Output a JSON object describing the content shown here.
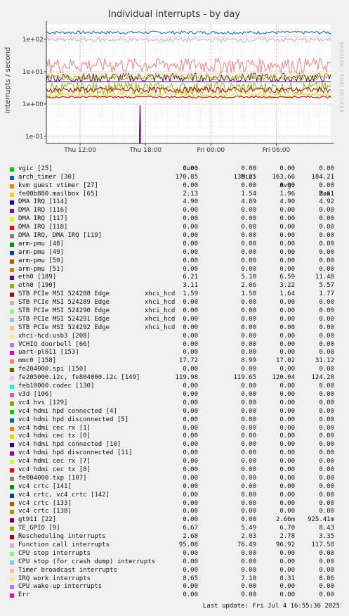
{
  "chart_data": {
    "type": "line",
    "title": "Individual interrupts - by day",
    "ylabel": "interrupts / second",
    "yscale": "log",
    "ylim": [
      0.06,
      300
    ],
    "yticks": [
      {
        "v": 100,
        "label": "1e+02"
      },
      {
        "v": 10,
        "label": "1e+01"
      },
      {
        "v": 1,
        "label": "1e+00"
      },
      {
        "v": 0.1,
        "label": "1e-01"
      }
    ],
    "x_range_hours": [
      8.9,
      35.0
    ],
    "xticks": [
      {
        "h": 12,
        "label": "Thu 12:00"
      },
      {
        "h": 18,
        "label": "Thu 18:00"
      },
      {
        "h": 24,
        "label": "Fri 00:00"
      },
      {
        "h": 30,
        "label": "Fri 06:00"
      },
      {
        "h": 36,
        "label": "Fri 12:00"
      }
    ],
    "watermark": "RRDTOOL / TOBI OETIKER",
    "columns": [
      "Cur:",
      "Min:",
      "Avg:",
      "Max:"
    ],
    "series": [
      {
        "name": "vgic [25]",
        "color": "#00cc00",
        "cur": "0.00",
        "min": "0.00",
        "avg": "0.00",
        "max": "0.00"
      },
      {
        "name": "arch_timer [30]",
        "color": "#0066b3",
        "cur": "170.85",
        "min": "138.25",
        "avg": "163.66",
        "max": "184.21"
      },
      {
        "name": "kvm guest vtimer [27]",
        "color": "#ff8000",
        "cur": "0.00",
        "min": "0.00",
        "avg": "0.00",
        "max": "0.00"
      },
      {
        "name": "fe00b880.mailbox [65]",
        "color": "#ffcc00",
        "cur": "2.13",
        "min": "1.54",
        "avg": "1.96",
        "max": "2.61"
      },
      {
        "name": "DMA IRQ [114]",
        "color": "#330099",
        "cur": "4.90",
        "min": "4.89",
        "avg": "4.90",
        "max": "4.92"
      },
      {
        "name": "DMA IRQ [116]",
        "color": "#990099",
        "cur": "0.00",
        "min": "0.00",
        "avg": "0.00",
        "max": "0.00"
      },
      {
        "name": "DMA IRQ [117]",
        "color": "#ccff00",
        "cur": "0.00",
        "min": "0.00",
        "avg": "0.00",
        "max": "0.00"
      },
      {
        "name": "DMA IRQ [118]",
        "color": "#ff0000",
        "cur": "0.00",
        "min": "0.00",
        "avg": "0.00",
        "max": "0.00"
      },
      {
        "name": "DMA IRQ, DMA IRQ [119]",
        "color": "#808080",
        "cur": "0.00",
        "min": "0.00",
        "avg": "0.00",
        "max": "0.00"
      },
      {
        "name": "arm-pmu [48]",
        "color": "#008f00",
        "cur": "0.00",
        "min": "0.00",
        "avg": "0.00",
        "max": "0.00"
      },
      {
        "name": "arm-pmu [49]",
        "color": "#00487d",
        "cur": "0.00",
        "min": "0.00",
        "avg": "0.00",
        "max": "0.00"
      },
      {
        "name": "arm-pmu [50]",
        "color": "#b35a00",
        "cur": "0.00",
        "min": "0.00",
        "avg": "0.00",
        "max": "0.00"
      },
      {
        "name": "arm-pmu [51]",
        "color": "#b38f00",
        "cur": "0.00",
        "min": "0.00",
        "avg": "0.00",
        "max": "0.00"
      },
      {
        "name": "eth0 [189]",
        "color": "#6b006b",
        "cur": "6.21",
        "min": "5.10",
        "avg": "6.59",
        "max": "11.48"
      },
      {
        "name": "eth0 [190]",
        "color": "#8fb300",
        "cur": "3.11",
        "min": "2.06",
        "avg": "3.22",
        "max": "5.57"
      },
      {
        "name": "STB PCIe MSI 524288 Edge",
        "extra": "xhci_hcd",
        "color": "#b30000",
        "cur": "1.59",
        "min": "1.50",
        "avg": "1.64",
        "max": "1.77"
      },
      {
        "name": "STB PCIe MSI 524289 Edge",
        "extra": "xhci_hcd",
        "color": "#bebebe",
        "cur": "0.00",
        "min": "0.00",
        "avg": "0.00",
        "max": "0.00"
      },
      {
        "name": "STB PCIe MSI 524290 Edge",
        "extra": "xhci_hcd",
        "color": "#80ff80",
        "cur": "0.00",
        "min": "0.00",
        "avg": "0.00",
        "max": "0.00"
      },
      {
        "name": "STB PCIe MSI 524291 Edge",
        "extra": "xhci_hcd",
        "color": "#80c9ff",
        "cur": "0.00",
        "min": "0.00",
        "avg": "0.00",
        "max": "0.00"
      },
      {
        "name": "STB PCIe MSI 524292 Edge",
        "extra": "xhci_hcd",
        "color": "#ffc080",
        "cur": "0.00",
        "min": "0.00",
        "avg": "0.00",
        "max": "0.00"
      },
      {
        "name": "xhci-hcd:usb3 [208]",
        "color": "#ffe680",
        "cur": "0.00",
        "min": "0.00",
        "avg": "0.00",
        "max": "0.00"
      },
      {
        "name": "VCHIQ doorbell [66]",
        "color": "#aa80ff",
        "cur": "0.00",
        "min": "0.00",
        "avg": "0.00",
        "max": "0.00"
      },
      {
        "name": "uart-pl011 [153]",
        "color": "#ee00cc",
        "cur": "0.00",
        "min": "0.00",
        "avg": "0.00",
        "max": "0.00"
      },
      {
        "name": "mmc0 [158]",
        "color": "#ff8080",
        "cur": "17.72",
        "min": "8.99",
        "avg": "17.02",
        "max": "31.12"
      },
      {
        "name": "fe204000.spi [150]",
        "color": "#666600",
        "cur": "0.00",
        "min": "0.00",
        "avg": "0.00",
        "max": "0.00"
      },
      {
        "name": "fe205000.i2c, fe804000.i2c [149]",
        "color": "#ffbfff",
        "cur": "119.98",
        "min": "119.65",
        "avg": "120.04",
        "max": "124.28"
      },
      {
        "name": "feb10000.codec [130]",
        "color": "#00ffcc",
        "cur": "0.00",
        "min": "0.00",
        "avg": "0.00",
        "max": "0.00"
      },
      {
        "name": "v3d [106]",
        "color": "#cc6699",
        "cur": "0.00",
        "min": "0.00",
        "avg": "0.00",
        "max": "0.00"
      },
      {
        "name": "vc4 hvs [129]",
        "color": "#999900",
        "cur": "0.00",
        "min": "0.00",
        "avg": "0.00",
        "max": "0.00"
      },
      {
        "name": "vc4 hdmi hpd connected [4]",
        "color": "#00cc00",
        "cur": "0.00",
        "min": "0.00",
        "avg": "0.00",
        "max": "0.00"
      },
      {
        "name": "vc4 hdmi hpd disconnected [5]",
        "color": "#0066b3",
        "cur": "0.00",
        "min": "0.00",
        "avg": "0.00",
        "max": "0.00"
      },
      {
        "name": "vc4 hdmi cec rx [1]",
        "color": "#ff8000",
        "cur": "0.00",
        "min": "0.00",
        "avg": "0.00",
        "max": "0.00"
      },
      {
        "name": "vc4 hdmi cec tx [0]",
        "color": "#ffcc00",
        "cur": "0.00",
        "min": "0.00",
        "avg": "0.00",
        "max": "0.00"
      },
      {
        "name": "vc4 hdmi hpd connected [10]",
        "color": "#330099",
        "cur": "0.00",
        "min": "0.00",
        "avg": "0.00",
        "max": "0.00"
      },
      {
        "name": "vc4 hdmi hpd disconnected [11]",
        "color": "#990099",
        "cur": "0.00",
        "min": "0.00",
        "avg": "0.00",
        "max": "0.00"
      },
      {
        "name": "vc4 hdmi cec rx [7]",
        "color": "#ccff00",
        "cur": "0.00",
        "min": "0.00",
        "avg": "0.00",
        "max": "0.00"
      },
      {
        "name": "vc4 hdmi cec tx [8]",
        "color": "#ff0000",
        "cur": "0.00",
        "min": "0.00",
        "avg": "0.00",
        "max": "0.00"
      },
      {
        "name": "fe004000.txp [107]",
        "color": "#808080",
        "cur": "0.00",
        "min": "0.00",
        "avg": "0.00",
        "max": "0.00"
      },
      {
        "name": "vc4 crtc [141]",
        "color": "#008f00",
        "cur": "0.00",
        "min": "0.00",
        "avg": "0.00",
        "max": "0.00"
      },
      {
        "name": "vc4 crtc, vc4 crtc [142]",
        "color": "#00487d",
        "cur": "0.00",
        "min": "0.00",
        "avg": "0.00",
        "max": "0.00"
      },
      {
        "name": "vc4 crtc [133]",
        "color": "#b35a00",
        "cur": "0.00",
        "min": "0.00",
        "avg": "0.00",
        "max": "0.00"
      },
      {
        "name": "vc4 crtc [138]",
        "color": "#b38f00",
        "cur": "0.00",
        "min": "0.00",
        "avg": "0.00",
        "max": "0.00"
      },
      {
        "name": "gt911 [22]",
        "color": "#6b006b",
        "cur": "0.00",
        "min": "0.00",
        "avg": "2.66m",
        "max": "925.41m"
      },
      {
        "name": "TE_GPIO [9]",
        "color": "#8fb300",
        "cur": "6.67",
        "min": "5.49",
        "avg": "6.70",
        "max": "8.43"
      },
      {
        "name": "Rescheduling interrupts",
        "color": "#b30000",
        "cur": "2.68",
        "min": "2.03",
        "avg": "2.78",
        "max": "3.35"
      },
      {
        "name": "Function call interrupts",
        "color": "#bebebe",
        "cur": "95.08",
        "min": "76.49",
        "avg": "96.92",
        "max": "117.58"
      },
      {
        "name": "CPU stop interrupts",
        "color": "#80ff80",
        "cur": "0.00",
        "min": "0.00",
        "avg": "0.00",
        "max": "0.00"
      },
      {
        "name": "CPU stop (for crash dump) interrupts",
        "color": "#80c9ff",
        "cur": "0.00",
        "min": "0.00",
        "avg": "0.00",
        "max": "0.00"
      },
      {
        "name": "Timer broadcast interrupts",
        "color": "#ffc080",
        "cur": "0.00",
        "min": "0.00",
        "avg": "0.00",
        "max": "0.00"
      },
      {
        "name": "IRQ work interrupts",
        "color": "#ffe680",
        "cur": "8.65",
        "min": "7.18",
        "avg": "8.31",
        "max": "8.86"
      },
      {
        "name": "CPU wake-up interrupts",
        "color": "#aa80ff",
        "cur": "0.00",
        "min": "0.00",
        "avg": "0.00",
        "max": "0.00"
      },
      {
        "name": "Err",
        "color": "#ee00cc",
        "cur": "0.00",
        "min": "0.00",
        "avg": "0.00",
        "max": "0.00"
      }
    ]
  },
  "footer": {
    "last_update": "Last update: Fri Jul  4 16:55:36 2025"
  }
}
